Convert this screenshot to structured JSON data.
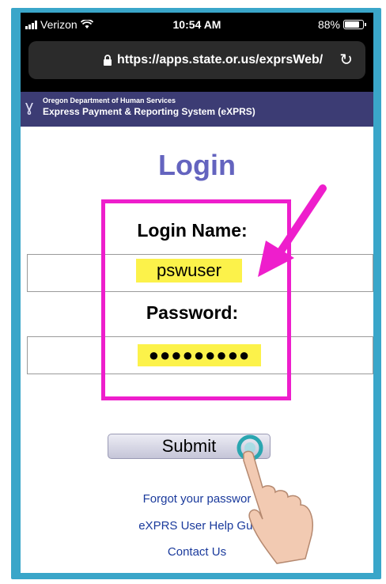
{
  "status_bar": {
    "carrier": "Verizon",
    "time": "10:54 AM",
    "battery": "88%",
    "battery_level": 0.88
  },
  "browser": {
    "url": "https://apps.state.or.us/exprsWeb/"
  },
  "banner": {
    "department": "Oregon Department of Human Services",
    "system": "Express Payment & Reporting System (eXPRS)"
  },
  "login": {
    "title": "Login",
    "name_label": "Login Name:",
    "name_value": "pswuser",
    "password_label": "Password:",
    "password_value": "●●●●●●●●●",
    "submit_label": "Submit"
  },
  "links": {
    "forgot": "Forgot your passwor",
    "help": "eXPRS User Help Gui",
    "contact": "Contact Us"
  },
  "colors": {
    "frame": "#3aa6c9",
    "banner": "#3c3c74",
    "title": "#6464bf",
    "annotation": "#ee1ecc",
    "highlight": "#fcf24a",
    "link": "#1a3a9c"
  },
  "icons": [
    "signal-icon",
    "wifi-icon",
    "battery-icon",
    "lock-icon",
    "reload-icon",
    "oregon-logo-icon",
    "arrow-annotation-icon",
    "pointing-hand-icon",
    "tap-indicator-icon"
  ]
}
